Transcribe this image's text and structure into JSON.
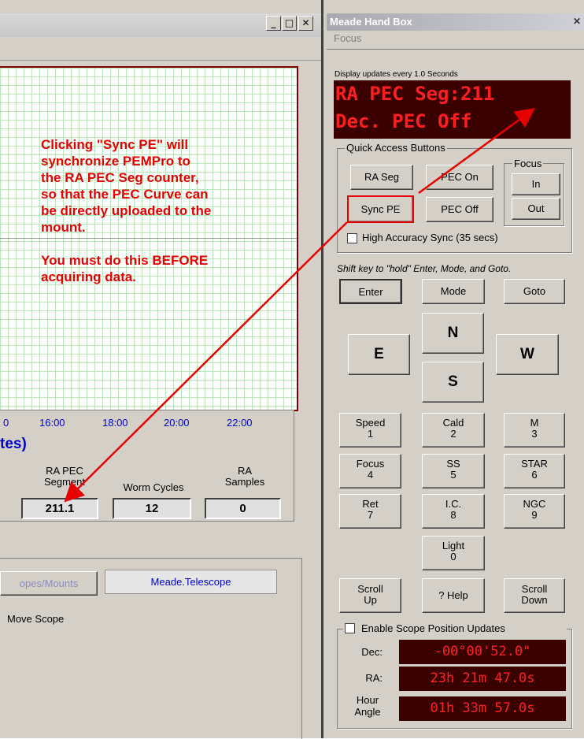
{
  "left_window": {
    "controls": {
      "minimize": "_",
      "maximize": "□",
      "close": "✕"
    },
    "x_ticks": [
      "0",
      "16:00",
      "18:00",
      "20:00",
      "22:00"
    ],
    "x_axis_fragment": "tes)",
    "annotation": {
      "line1": "Clicking \"Sync PE\" will",
      "line2": "synchronize PEMPro to",
      "line3": "the RA PEC Seg counter,",
      "line4": "so that the PEC Curve can",
      "line5": "be directly uploaded to the",
      "line6": "mount.",
      "line7": "You must do this BEFORE",
      "line8": "acquiring data."
    },
    "stats": {
      "ra_pec_label1": "RA PEC",
      "ra_pec_label2": "Segment",
      "ra_pec_value": "211.1",
      "worm_label": "Worm Cycles",
      "worm_value": "12",
      "ra_samples_label1": "RA",
      "ra_samples_label2": "Samples",
      "ra_samples_value": "0"
    },
    "scope": {
      "scopes_button": "opes/Mounts",
      "driver_field": "Meade.Telescope",
      "move_scope": "Move Scope"
    }
  },
  "handbox": {
    "title": "Meade Hand Box",
    "close": "✕",
    "menu_focus": "Focus",
    "update_text": "Display updates every 1.0 Seconds",
    "lcd_line1": "RA PEC Seg:211",
    "lcd_line2": "Dec. PEC Off",
    "quick_access": "Quick Access Buttons",
    "ra_seg": "RA Seg",
    "pec_on": "PEC On",
    "sync_pe": "Sync PE",
    "pec_off": "PEC Off",
    "focus_group": "Focus",
    "focus_in": "In",
    "focus_out": "Out",
    "high_accuracy": "High Accuracy Sync (35 secs)",
    "shift_hint": "Shift key to \"hold\" Enter, Mode, and Goto.",
    "enter": "Enter",
    "mode": "Mode",
    "goto": "Goto",
    "north": "N",
    "east": "E",
    "west": "W",
    "south": "S",
    "keypad": [
      {
        "top": "Speed",
        "num": "1"
      },
      {
        "top": "Cald",
        "num": "2"
      },
      {
        "top": "M",
        "num": "3"
      },
      {
        "top": "Focus",
        "num": "4"
      },
      {
        "top": "SS",
        "num": "5"
      },
      {
        "top": "STAR",
        "num": "6"
      },
      {
        "top": "Ret",
        "num": "7"
      },
      {
        "top": "I.C.",
        "num": "8"
      },
      {
        "top": "NGC",
        "num": "9"
      },
      {
        "top": "Light",
        "num": "0"
      }
    ],
    "scroll_up1": "Scroll",
    "scroll_up2": "Up",
    "help": "? Help",
    "scroll_down1": "Scroll",
    "scroll_down2": "Down",
    "enable_updates": "Enable Scope Position Updates",
    "dec_label": "Dec:",
    "dec_value": "-00°00'52.0\"",
    "ra_label": "RA:",
    "ra_value": "23h 21m 47.0s",
    "ha_label1": "Hour",
    "ha_label2": "Angle",
    "ha_value": "01h 33m 57.0s"
  },
  "colors": {
    "annotation": "#e60000",
    "lcd_bg": "#3a0000",
    "lcd_text": "#ff1f1f",
    "grid": "#b9e8b9",
    "tick_text": "#0000cc"
  }
}
